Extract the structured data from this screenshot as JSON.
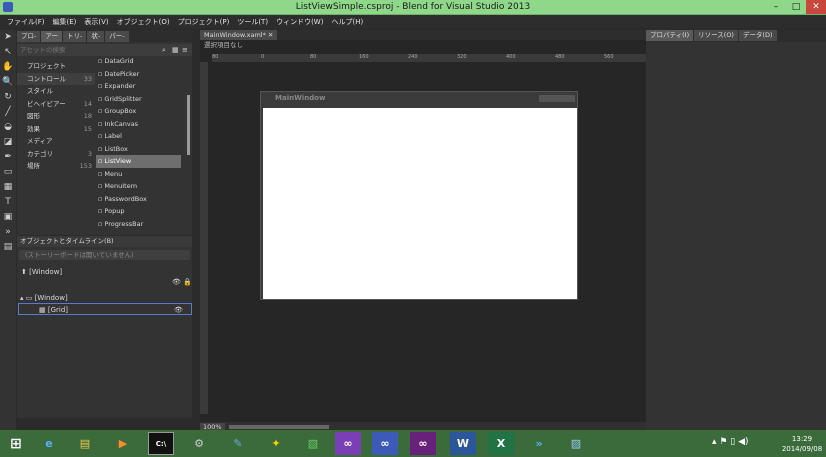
{
  "window": {
    "title": "ListViewSimple.csproj - Blend for Visual Studio 2013",
    "minimize": "–",
    "maximize": "□",
    "close": "✕"
  },
  "menu": [
    "ファイル(F)",
    "編集(E)",
    "表示(V)",
    "オブジェクト(O)",
    "プロジェクト(P)",
    "ツール(T)",
    "ウィンドウ(W)",
    "ヘルプ(H)"
  ],
  "assets": {
    "tabs": [
      "プロ-",
      "アー",
      "トリ-",
      "状-",
      "パー-"
    ],
    "search_placeholder": "アセットの検索",
    "categories": [
      {
        "label": "プロジェクト",
        "count": ""
      },
      {
        "label": "コントロール",
        "count": "33"
      },
      {
        "label": "スタイル",
        "count": ""
      },
      {
        "label": "ビヘイビアー",
        "count": "14"
      },
      {
        "label": "図形",
        "count": "18"
      },
      {
        "label": "効果",
        "count": "15"
      },
      {
        "label": "メディア",
        "count": ""
      },
      {
        "label": "カテゴリ",
        "count": "3"
      },
      {
        "label": "場所",
        "count": "153"
      }
    ],
    "controls": [
      "DataGrid",
      "DatePicker",
      "Expander",
      "GridSplitter",
      "GroupBox",
      "InkCanvas",
      "Label",
      "ListBox",
      "ListView",
      "Menu",
      "MenuItem",
      "PasswordBox",
      "Popup",
      "ProgressBar"
    ],
    "selected": "ListView"
  },
  "objects": {
    "title": "オブジェクトとタイムライン(B)",
    "storyboard_placeholder": "(ストーリーボードは開いていません)",
    "root": "[Window]",
    "tree": [
      "[Window]",
      "[Grid]"
    ]
  },
  "document": {
    "tab": "MainWindow.xaml*",
    "breadcrumb": "選択項目なし",
    "window_title": "MainWindow",
    "ruler_ticks": [
      "80",
      "0",
      "80",
      "160",
      "240",
      "320",
      "400",
      "480",
      "560"
    ],
    "zoom": "100%"
  },
  "right": {
    "tabs": [
      "プロパティ(I)",
      "リソース(O)",
      "データ(D)"
    ]
  },
  "clock": {
    "time": "13:29",
    "date": "2014/09/08"
  }
}
